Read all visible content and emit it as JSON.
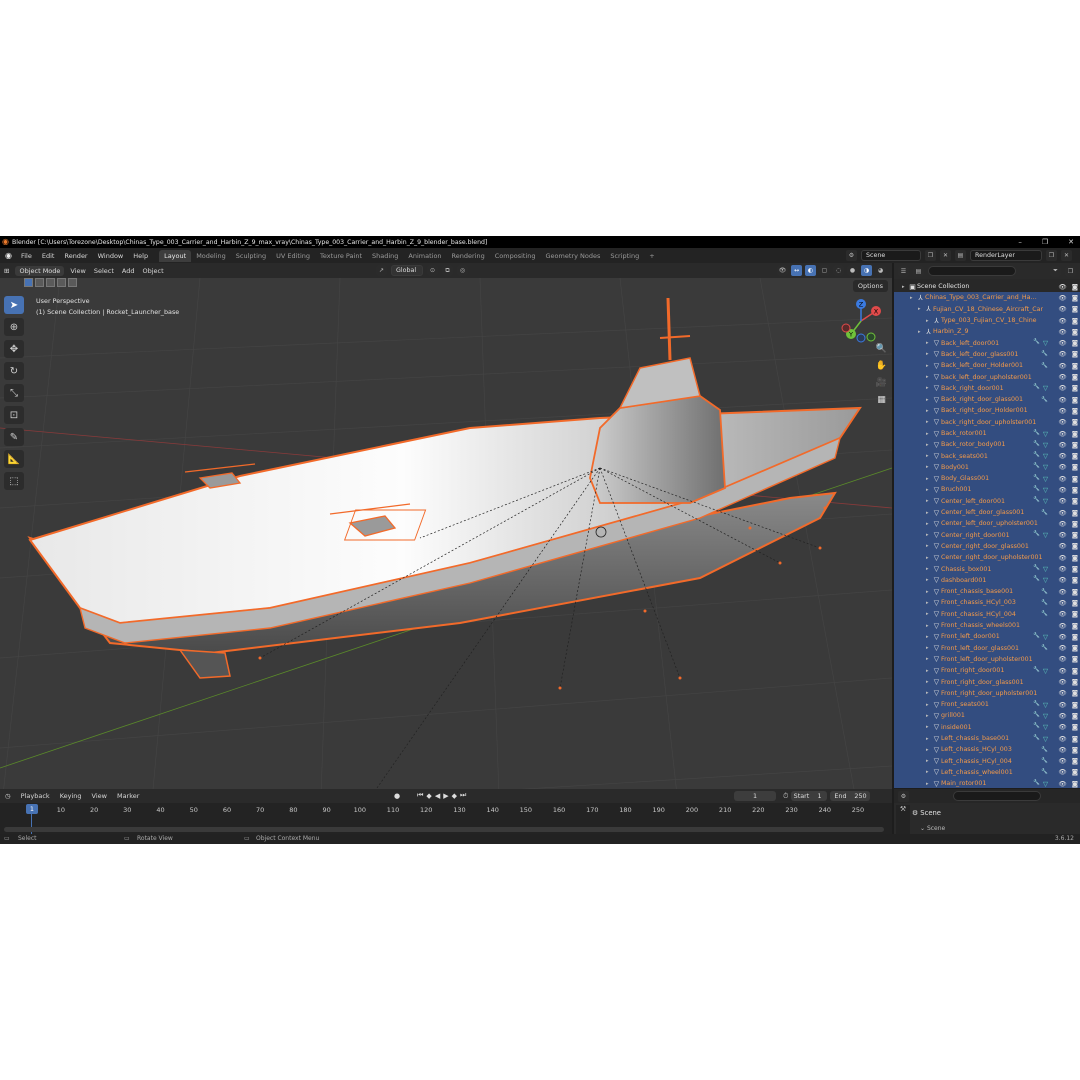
{
  "title_bar": {
    "text": "Blender [C:\\Users\\Torezone\\Desktop\\Chinas_Type_003_Carrier_and_Harbin_Z_9_max_vray\\Chinas_Type_003_Carrier_and_Harbin_Z_9_blender_base.blend]",
    "min": "–",
    "max": "❐",
    "close": "✕"
  },
  "menu": [
    "File",
    "Edit",
    "Render",
    "Window",
    "Help"
  ],
  "workspaces": [
    "Layout",
    "Modeling",
    "Sculpting",
    "UV Editing",
    "Texture Paint",
    "Shading",
    "Animation",
    "Rendering",
    "Compositing",
    "Geometry Nodes",
    "Scripting"
  ],
  "workspace_add": "+",
  "scene_field": "Scene",
  "view_layer_field": "RenderLayer",
  "viewport_header": {
    "mode": "Object Mode",
    "items": [
      "View",
      "Select",
      "Add",
      "Object"
    ],
    "transform_orientation": "Global",
    "options": "Options"
  },
  "viewport": {
    "perspective": "User Perspective",
    "collection_info": "(1) Scene Collection | Rocket_Launcher_base",
    "axis_labels": {
      "x": "X",
      "y": "Y",
      "z": "Z"
    }
  },
  "outliner": {
    "search_placeholder": "",
    "rows": [
      {
        "indent": 0,
        "name": "Scene Collection",
        "icon": "collection",
        "white": true,
        "sel": false,
        "mods": []
      },
      {
        "indent": 1,
        "name": "Chinas_Type_003_Carrier_and_Harbin_Z",
        "icon": "empty",
        "white": false,
        "sel": true,
        "mods": []
      },
      {
        "indent": 2,
        "name": "Fujian_CV_18_Chinese_Aircraft_Car",
        "icon": "empty",
        "white": false,
        "sel": true,
        "mods": []
      },
      {
        "indent": 3,
        "name": "Type_003_Fujian_CV_18_Chine",
        "icon": "empty",
        "white": false,
        "sel": true,
        "mods": []
      },
      {
        "indent": 2,
        "name": "Harbin_Z_9",
        "icon": "empty",
        "white": false,
        "sel": true,
        "mods": []
      },
      {
        "indent": 3,
        "name": "Back_left_door001",
        "icon": "mesh",
        "white": false,
        "sel": true,
        "mods": [
          "w",
          "g"
        ]
      },
      {
        "indent": 3,
        "name": "Back_left_door_glass001",
        "icon": "mesh",
        "white": false,
        "sel": true,
        "mods": [
          "w"
        ]
      },
      {
        "indent": 3,
        "name": "Back_left_door_Holder001",
        "icon": "mesh",
        "white": false,
        "sel": true,
        "mods": [
          "w"
        ]
      },
      {
        "indent": 3,
        "name": "back_left_door_upholster001",
        "icon": "mesh",
        "white": false,
        "sel": true,
        "mods": []
      },
      {
        "indent": 3,
        "name": "Back_right_door001",
        "icon": "mesh",
        "white": false,
        "sel": true,
        "mods": [
          "w",
          "g"
        ]
      },
      {
        "indent": 3,
        "name": "Back_right_door_glass001",
        "icon": "mesh",
        "white": false,
        "sel": true,
        "mods": [
          "w"
        ]
      },
      {
        "indent": 3,
        "name": "Back_right_door_Holder001",
        "icon": "mesh",
        "white": false,
        "sel": true,
        "mods": []
      },
      {
        "indent": 3,
        "name": "back_right_door_upholster001",
        "icon": "mesh",
        "white": false,
        "sel": true,
        "mods": []
      },
      {
        "indent": 3,
        "name": "Back_rotor001",
        "icon": "mesh",
        "white": false,
        "sel": true,
        "mods": [
          "w",
          "g"
        ]
      },
      {
        "indent": 3,
        "name": "Back_rotor_body001",
        "icon": "mesh",
        "white": false,
        "sel": true,
        "mods": [
          "w",
          "g"
        ]
      },
      {
        "indent": 3,
        "name": "back_seats001",
        "icon": "mesh",
        "white": false,
        "sel": true,
        "mods": [
          "w",
          "g"
        ]
      },
      {
        "indent": 3,
        "name": "Body001",
        "icon": "mesh",
        "white": false,
        "sel": true,
        "mods": [
          "w",
          "g"
        ]
      },
      {
        "indent": 3,
        "name": "Body_Glass001",
        "icon": "mesh",
        "white": false,
        "sel": true,
        "mods": [
          "w",
          "g"
        ]
      },
      {
        "indent": 3,
        "name": "Bruch001",
        "icon": "mesh",
        "white": false,
        "sel": true,
        "mods": [
          "w",
          "g"
        ]
      },
      {
        "indent": 3,
        "name": "Center_left_door001",
        "icon": "mesh",
        "white": false,
        "sel": true,
        "mods": [
          "w",
          "g"
        ]
      },
      {
        "indent": 3,
        "name": "Center_left_door_glass001",
        "icon": "mesh",
        "white": false,
        "sel": true,
        "mods": [
          "w"
        ]
      },
      {
        "indent": 3,
        "name": "Center_left_door_upholster001",
        "icon": "mesh",
        "white": false,
        "sel": true,
        "mods": []
      },
      {
        "indent": 3,
        "name": "Center_right_door001",
        "icon": "mesh",
        "white": false,
        "sel": true,
        "mods": [
          "w",
          "g"
        ]
      },
      {
        "indent": 3,
        "name": "Center_right_door_glass001",
        "icon": "mesh",
        "white": false,
        "sel": true,
        "mods": []
      },
      {
        "indent": 3,
        "name": "Center_right_door_upholster001",
        "icon": "mesh",
        "white": false,
        "sel": true,
        "mods": []
      },
      {
        "indent": 3,
        "name": "Chassis_box001",
        "icon": "mesh",
        "white": false,
        "sel": true,
        "mods": [
          "w",
          "g"
        ]
      },
      {
        "indent": 3,
        "name": "dashboard001",
        "icon": "mesh",
        "white": false,
        "sel": true,
        "mods": [
          "w",
          "g"
        ]
      },
      {
        "indent": 3,
        "name": "Front_chassis_base001",
        "icon": "mesh",
        "white": false,
        "sel": true,
        "mods": [
          "w"
        ]
      },
      {
        "indent": 3,
        "name": "Front_chassis_HCyl_003",
        "icon": "mesh",
        "white": false,
        "sel": true,
        "mods": [
          "w"
        ]
      },
      {
        "indent": 3,
        "name": "Front_chassis_HCyl_004",
        "icon": "mesh",
        "white": false,
        "sel": true,
        "mods": [
          "w"
        ]
      },
      {
        "indent": 3,
        "name": "Front_chassis_wheels001",
        "icon": "mesh",
        "white": false,
        "sel": true,
        "mods": []
      },
      {
        "indent": 3,
        "name": "Front_left_door001",
        "icon": "mesh",
        "white": false,
        "sel": true,
        "mods": [
          "w",
          "g"
        ]
      },
      {
        "indent": 3,
        "name": "Front_left_door_glass001",
        "icon": "mesh",
        "white": false,
        "sel": true,
        "mods": [
          "w"
        ]
      },
      {
        "indent": 3,
        "name": "Front_left_door_upholster001",
        "icon": "mesh",
        "white": false,
        "sel": true,
        "mods": []
      },
      {
        "indent": 3,
        "name": "Front_right_door001",
        "icon": "mesh",
        "white": false,
        "sel": true,
        "mods": [
          "w",
          "g"
        ]
      },
      {
        "indent": 3,
        "name": "Front_right_door_glass001",
        "icon": "mesh",
        "white": false,
        "sel": true,
        "mods": []
      },
      {
        "indent": 3,
        "name": "Front_right_door_upholster001",
        "icon": "mesh",
        "white": false,
        "sel": true,
        "mods": []
      },
      {
        "indent": 3,
        "name": "Front_seats001",
        "icon": "mesh",
        "white": false,
        "sel": true,
        "mods": [
          "w",
          "g"
        ]
      },
      {
        "indent": 3,
        "name": "grill001",
        "icon": "mesh",
        "white": false,
        "sel": true,
        "mods": [
          "w",
          "g"
        ]
      },
      {
        "indent": 3,
        "name": "inside001",
        "icon": "mesh",
        "white": false,
        "sel": true,
        "mods": [
          "w",
          "g"
        ]
      },
      {
        "indent": 3,
        "name": "Left_chassis_base001",
        "icon": "mesh",
        "white": false,
        "sel": true,
        "mods": [
          "w",
          "g"
        ]
      },
      {
        "indent": 3,
        "name": "Left_chassis_HCyl_003",
        "icon": "mesh",
        "white": false,
        "sel": true,
        "mods": [
          "w"
        ]
      },
      {
        "indent": 3,
        "name": "Left_chassis_HCyl_004",
        "icon": "mesh",
        "white": false,
        "sel": true,
        "mods": [
          "w"
        ]
      },
      {
        "indent": 3,
        "name": "Left_chassis_wheel001",
        "icon": "mesh",
        "white": false,
        "sel": true,
        "mods": [
          "w"
        ]
      },
      {
        "indent": 3,
        "name": "Main_rotor001",
        "icon": "mesh",
        "white": false,
        "sel": true,
        "mods": [
          "w",
          "g"
        ]
      }
    ]
  },
  "timeline": {
    "header_items": [
      "Playback",
      "Keying",
      "View",
      "Marker"
    ],
    "current_frame": "1",
    "start_label": "Start",
    "start": "1",
    "end_label": "End",
    "end": "250",
    "ticks": [
      "1",
      "10",
      "20",
      "30",
      "40",
      "50",
      "60",
      "70",
      "80",
      "90",
      "100",
      "110",
      "120",
      "130",
      "140",
      "150",
      "160",
      "170",
      "180",
      "190",
      "200",
      "210",
      "220",
      "230",
      "240",
      "250"
    ]
  },
  "properties": {
    "scene": "Scene",
    "sub": "Scene"
  },
  "status_bar": {
    "select": "Select",
    "rotate": "Rotate View",
    "context": "Object Context Menu",
    "version": "3.6.12"
  },
  "colors": {
    "accent": "#4772b3",
    "selection_orange": "#f39a4a",
    "outliner_selected": "#334d80"
  }
}
